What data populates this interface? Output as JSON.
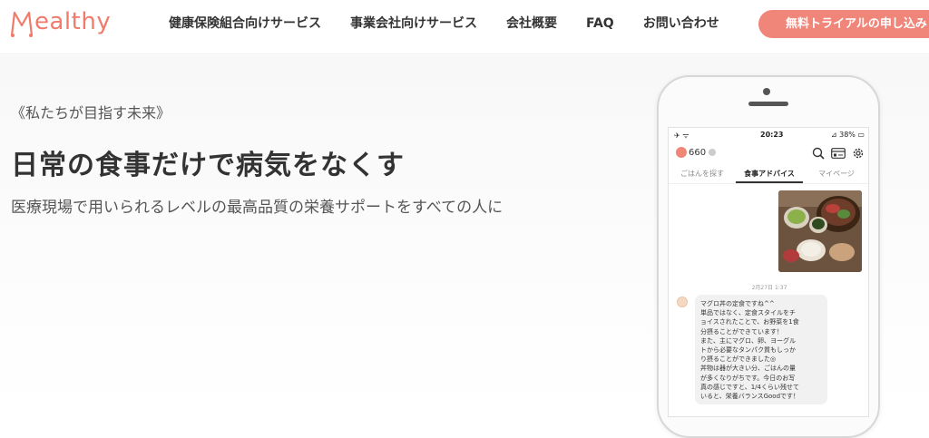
{
  "header": {
    "logo_text": "ealthy",
    "nav": [
      {
        "label": "健康保険組合向けサービス"
      },
      {
        "label": "事業会社向けサービス"
      },
      {
        "label": "会社概要"
      },
      {
        "label": "FAQ"
      },
      {
        "label": "お問い合わせ"
      }
    ],
    "cta_label": "無料トライアルの申し込み",
    "brand_color": "#f07b6b"
  },
  "hero": {
    "subtitle": "《私たちが目指す未来》",
    "title": "日常の食事だけで病気をなくす",
    "description": "医療現場で用いられるレベルの最高品質の栄養サポートをすべての人に"
  },
  "phone": {
    "status": {
      "left": "✈ ᯤ",
      "time": "20:23",
      "right": "⊿ 38% ▭"
    },
    "points": "660",
    "icons": [
      "search-icon",
      "card-icon",
      "gear-icon"
    ],
    "tabs": [
      {
        "label": "ごはんを探す",
        "active": false
      },
      {
        "label": "食事アドバイス",
        "active": true
      },
      {
        "label": "マイページ",
        "active": false
      }
    ],
    "timestamp": "2月27日 1:37",
    "message_lines": [
      "マグロ丼の定食ですね^^",
      "単品ではなく、定食スタイルをチ",
      "ョイスされたことで、お野菜を1食",
      "分摂ることができています！",
      "また、主にマグロ、卵、ヨーグル",
      "トから必要なタンパク質もしっか",
      "り摂ることができました◎",
      "丼物は器が大きい分、ごはんの量",
      "が多くなりがちです。今日のお写",
      "真の感じですと、1/4くらい残せて",
      "いると、栄養バランスGoodです！"
    ]
  }
}
